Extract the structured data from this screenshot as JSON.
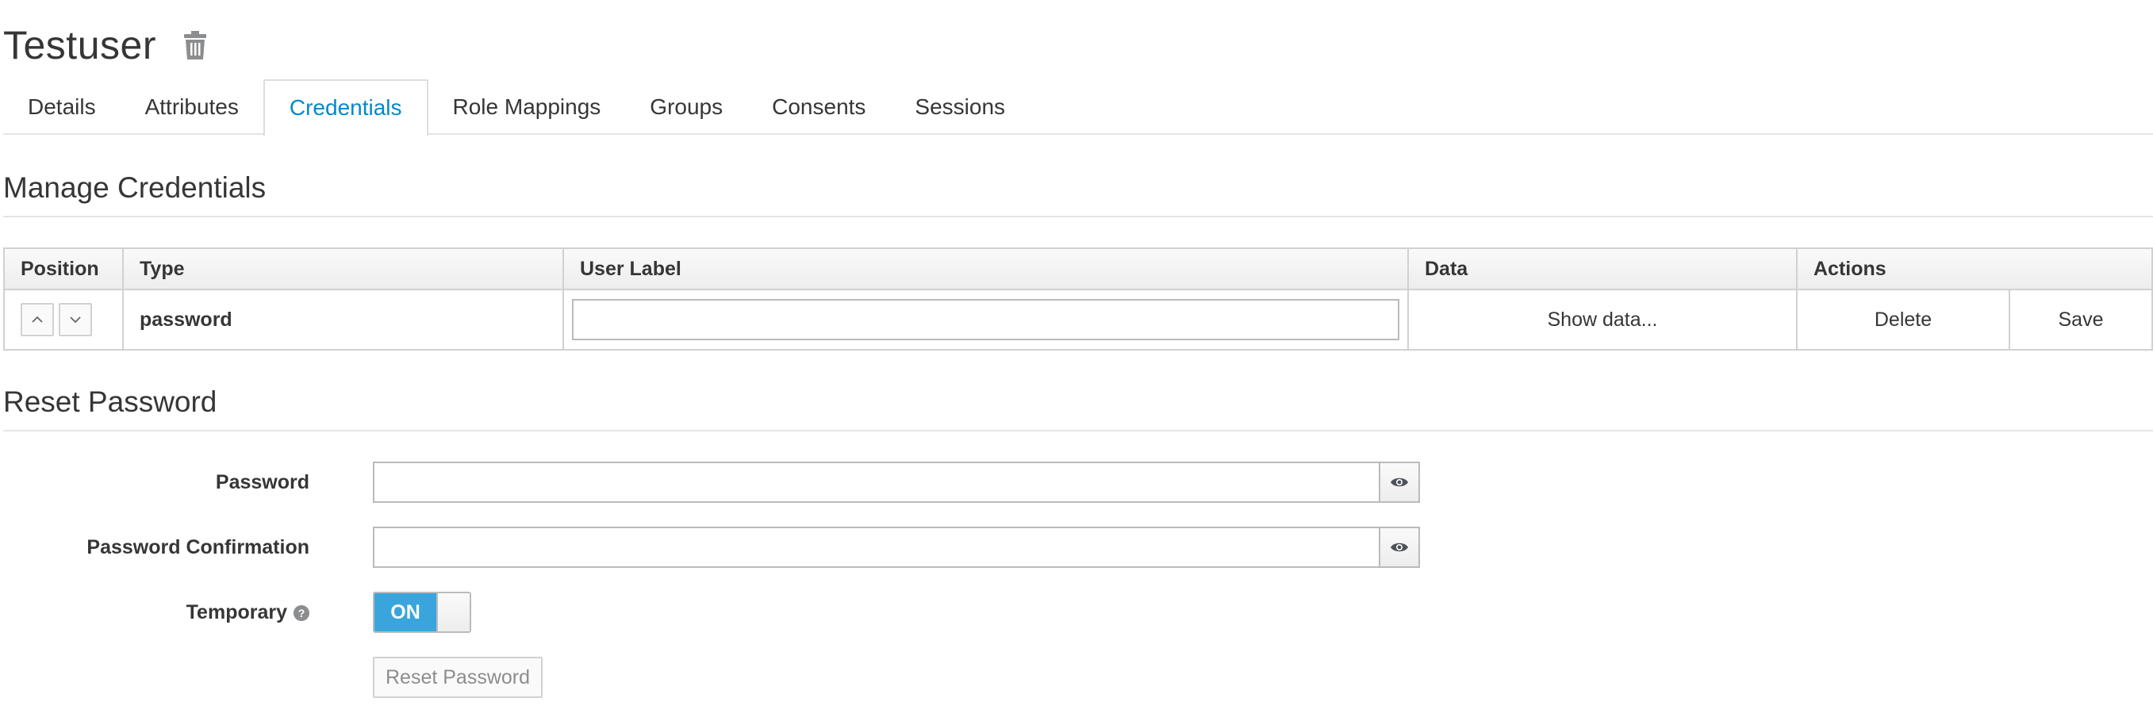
{
  "user": {
    "name": "Testuser",
    "delete_icon": "trash-icon"
  },
  "tabs": [
    {
      "label": "Details",
      "active": false
    },
    {
      "label": "Attributes",
      "active": false
    },
    {
      "label": "Credentials",
      "active": true
    },
    {
      "label": "Role Mappings",
      "active": false
    },
    {
      "label": "Groups",
      "active": false
    },
    {
      "label": "Consents",
      "active": false
    },
    {
      "label": "Sessions",
      "active": false
    }
  ],
  "manage_credentials": {
    "heading": "Manage Credentials",
    "columns": {
      "position": "Position",
      "type": "Type",
      "user_label": "User Label",
      "data": "Data",
      "actions": "Actions"
    },
    "rows": [
      {
        "move_up_icon": "chevron-up-icon",
        "move_down_icon": "chevron-down-icon",
        "type": "password",
        "user_label_value": "",
        "data_button": "Show data...",
        "delete_button": "Delete",
        "save_button": "Save"
      }
    ]
  },
  "reset_password": {
    "heading": "Reset Password",
    "password_label": "Password",
    "password_value": "",
    "confirmation_label": "Password Confirmation",
    "confirmation_value": "",
    "eye_icon": "eye-icon",
    "temporary_label": "Temporary",
    "help_icon": "question-circle-icon",
    "temporary_toggle": "ON",
    "temporary_on": true,
    "submit_button": "Reset Password"
  },
  "colors": {
    "accent": "#0088ce",
    "toggle_on": "#39a5dc",
    "text": "#363636",
    "border": "#d1d1d1"
  }
}
